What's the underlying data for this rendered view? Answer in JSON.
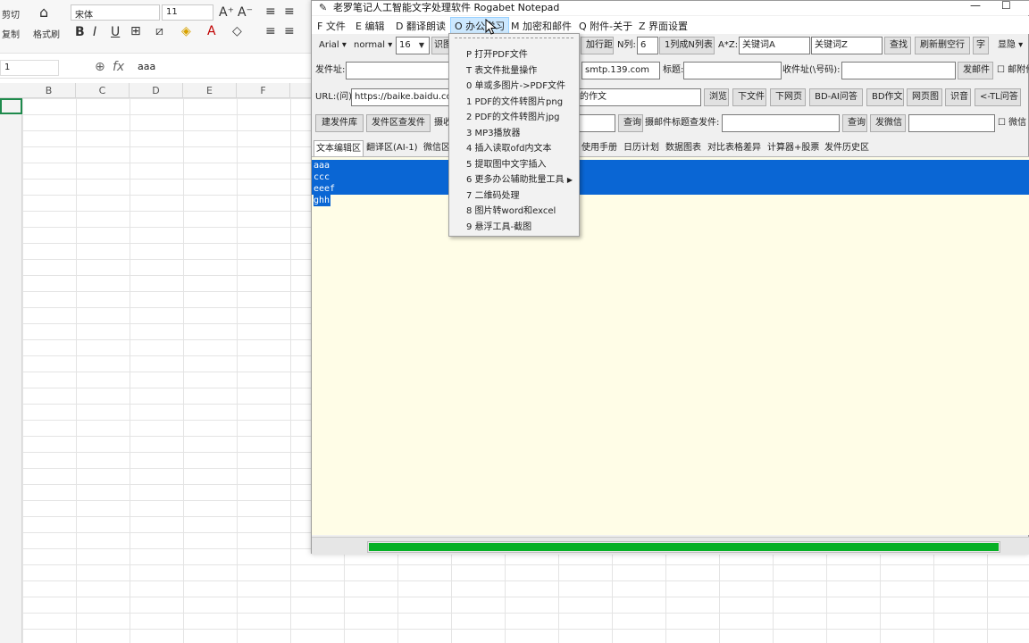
{
  "excel": {
    "ribbon": {
      "cut": "剪切",
      "copy": "复制",
      "format_painter": "格式刷",
      "font_name": "宋体",
      "font_size": "11"
    },
    "name_box": "1",
    "formula_value": "aaa",
    "columns": [
      "B",
      "C",
      "D",
      "E",
      "F"
    ]
  },
  "app": {
    "title": "老罗笔记人工智能文字处理软件 Rogabet Notepad",
    "menu": [
      {
        "label": "F 文件"
      },
      {
        "label": "E 编辑"
      },
      {
        "label": "D 翻译朗读"
      },
      {
        "label": "O 办公学习"
      },
      {
        "label": "M 加密和邮件"
      },
      {
        "label": "Q 附件-关于"
      },
      {
        "label": "Z 界面设置"
      }
    ],
    "toolbar1": {
      "font_family": "Arial",
      "font_weight": "normal",
      "font_size": "16",
      "btn_partial": "识图",
      "add_spacing": "加行距",
      "n_col_label": "N列:",
      "n_col_value": "6",
      "one_to_n": "1列成N列表",
      "az_label": "A*Z:",
      "keyword_a": "关键词A",
      "keyword_z": "关键词Z",
      "find": "查找",
      "refresh_delete_blank": "刷新删空行",
      "char": "字",
      "hide": "显隐"
    },
    "toolbar2": {
      "sender_label": "发件址:",
      "smtp": "smtp.139.com",
      "subject_label": "标题:",
      "recipient_label": "收件址(\\号码):",
      "send_mail": "发邮件",
      "attach_label": "邮附件"
    },
    "toolbar3": {
      "url_label": "URL:(问)",
      "url_value": "https://baike.baidu.co",
      "topic_value": "的作文",
      "browse": "浏览",
      "download_file": "下文件",
      "download_page": "下网页",
      "bd_ai": "BD-AI问答",
      "bd_essay": "BD作文",
      "web_page": "网页图",
      "recognize_voice": "识音",
      "tl_qa": "<-TL问答"
    },
    "toolbar4": {
      "build_mail_lib": "建发件库",
      "send_from_area": "发件区查发件",
      "partial_label": "摄收",
      "query1": "查询",
      "subject_search_label": "摄邮件标题查发件:",
      "query2": "查询",
      "send_wechat": "发微信",
      "wechat_label": "微信"
    },
    "tabs": [
      {
        "label": "文本编辑区"
      },
      {
        "label": "翻译区(AI-1)"
      },
      {
        "label": "微信区"
      },
      {
        "label": "使用手册"
      },
      {
        "label": "日历计划"
      },
      {
        "label": "数据图表"
      },
      {
        "label": "对比表格差异"
      },
      {
        "label": "计算器+股票"
      },
      {
        "label": "发件历史区"
      }
    ],
    "editor_lines": [
      "aaa",
      "ccc",
      "eeef",
      "ghh"
    ],
    "progress": 1.0,
    "colors": {
      "selection": "#0a66d4",
      "editor_bg": "#fffde7",
      "progress": "#06b025"
    }
  },
  "dropdown": {
    "items": [
      {
        "label": "P 打开PDF文件"
      },
      {
        "label": "T 表文件批量操作"
      },
      {
        "label": "0 单或多图片->PDF文件"
      },
      {
        "label": "1 PDF的文件转图片png"
      },
      {
        "label": "2 PDF的文件转图片jpg"
      },
      {
        "label": "3 MP3播放器"
      },
      {
        "label": "4 插入读取ofd内文本"
      },
      {
        "label": "5 提取图中文字插入"
      },
      {
        "label": "6 更多办公辅助批量工具"
      },
      {
        "label": "7 二维码处理"
      },
      {
        "label": "8 图片转word和excel"
      },
      {
        "label": "9 悬浮工具-截图"
      }
    ]
  }
}
